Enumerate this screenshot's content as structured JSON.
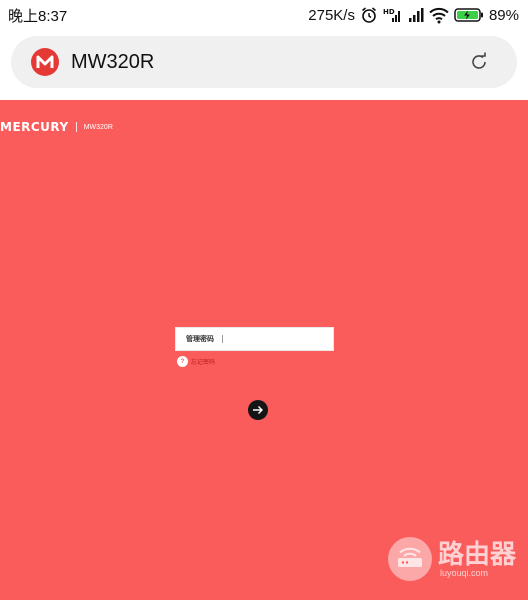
{
  "status_bar": {
    "time": "晚上8:37",
    "network_speed": "275K/s",
    "battery": "89%",
    "icons": [
      "alarm-icon",
      "hd-signal-icon",
      "cellular-signal-icon",
      "wifi-icon",
      "battery-charging-icon"
    ]
  },
  "browser": {
    "url": "MW320R",
    "site_icon": "mercury-logo-icon",
    "reload_icon": "reload-icon"
  },
  "router_page": {
    "background_color": "#fa5c5c",
    "brand_logo": "MERCURY",
    "model": "MW320R",
    "password_label": "管理密码",
    "forgot_password": "忘记密码",
    "login_icon": "arrow-right-icon"
  },
  "watermark": {
    "chinese": "路由器",
    "url": "luyouqi.com"
  }
}
